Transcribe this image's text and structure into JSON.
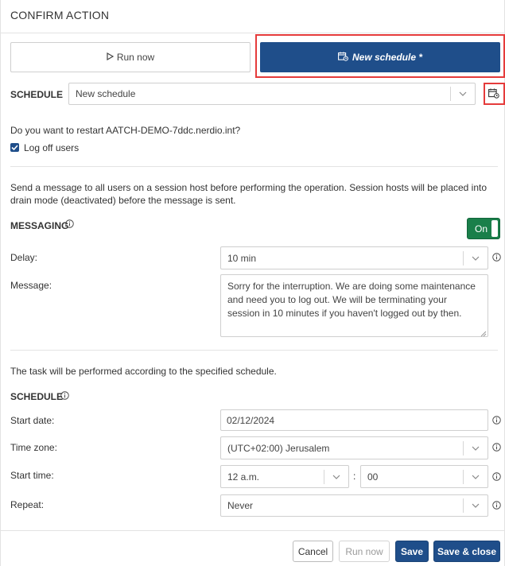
{
  "dialog": {
    "title": "CONFIRM ACTION"
  },
  "top_tabs": {
    "run_now": "Run now",
    "new_schedule": "New schedule *"
  },
  "schedule_picker": {
    "label": "SCHEDULE",
    "value": "New schedule"
  },
  "restart": {
    "question": "Do you want to restart AATCH-DEMO-7ddc.nerdio.int?",
    "logoff_label": "Log off users",
    "logoff_checked": true
  },
  "messaging": {
    "description": "Send a message to all users on a session host before performing the operation. Session hosts will be placed into drain mode (deactivated) before the message is sent.",
    "heading": "MESSAGING",
    "toggle_label": "On",
    "delay_label": "Delay:",
    "delay_value": "10 min",
    "message_label": "Message:",
    "message_value": "Sorry for the interruption. We are doing some maintenance and need you to log out. We will be terminating your session in 10 minutes if you haven't logged out by then."
  },
  "schedule": {
    "note": "The task will be performed according to the specified schedule.",
    "heading": "SCHEDULE",
    "start_date_label": "Start date:",
    "start_date_value": "02/12/2024",
    "timezone_label": "Time zone:",
    "timezone_value": "(UTC+02:00) Jerusalem",
    "start_time_label": "Start time:",
    "hour_value": "12 a.m.",
    "time_separator": ":",
    "minute_value": "00",
    "repeat_label": "Repeat:",
    "repeat_value": "Never"
  },
  "footer": {
    "cancel": "Cancel",
    "run_now": "Run now",
    "save": "Save",
    "save_close": "Save & close"
  },
  "colors": {
    "primary": "#1f4e8a",
    "toggle_on": "#1a7f4a",
    "highlight": "#e53b3b"
  },
  "icons": [
    "play-icon",
    "calendar-clock-icon",
    "chevron-down-icon",
    "info-icon",
    "check-icon"
  ]
}
